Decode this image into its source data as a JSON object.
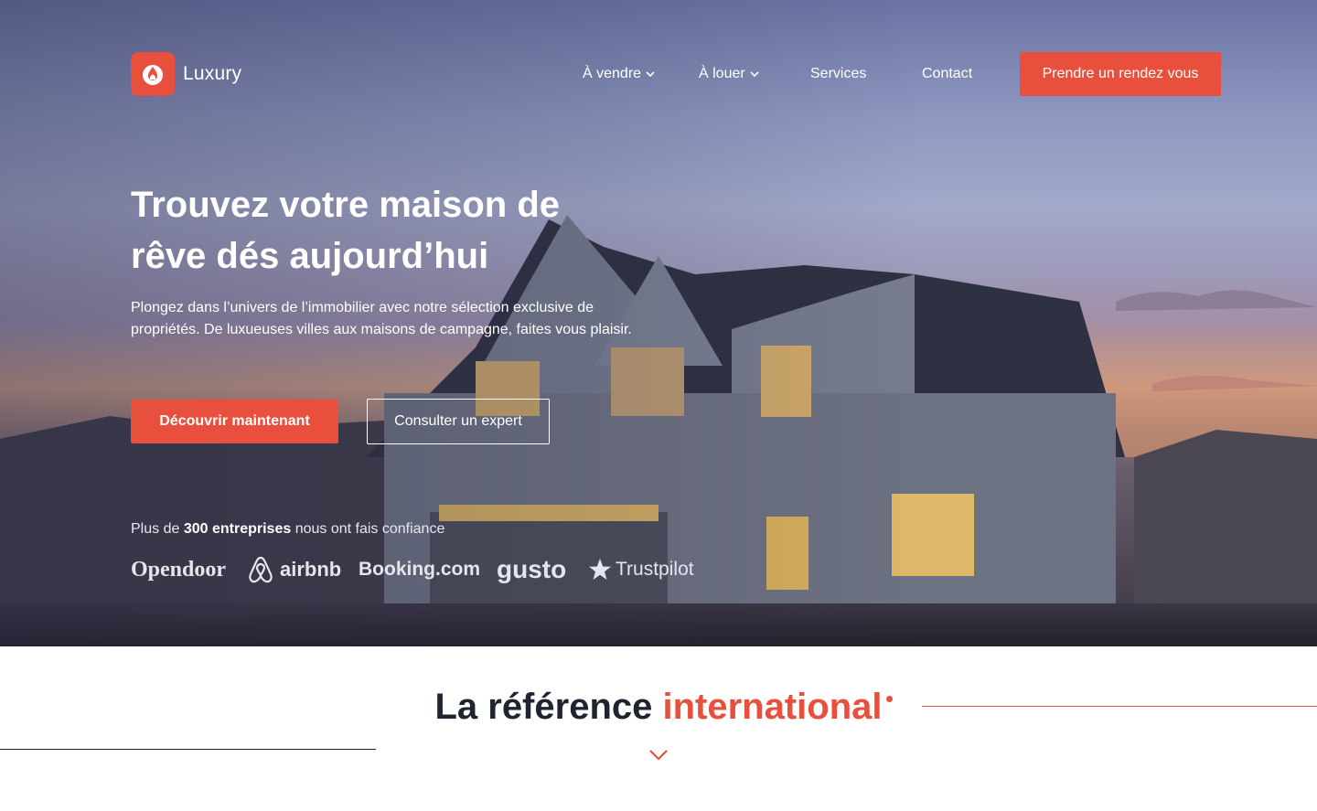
{
  "brand": {
    "name": "Luxury",
    "accent": "#e94f3d"
  },
  "nav": {
    "items": [
      {
        "label": "À vendre",
        "has_dropdown": true
      },
      {
        "label": "À louer",
        "has_dropdown": true
      },
      {
        "label": "Services",
        "has_dropdown": false
      },
      {
        "label": "Contact",
        "has_dropdown": false
      }
    ],
    "cta_label": "Prendre un rendez vous"
  },
  "hero": {
    "headline": "Trouvez votre maison de rêve dés aujourd’hui",
    "subtext": "Plongez dans l’univers de l’immobilier avec notre sélection exclusive de propriétés. De luxueuses villes aux maisons de campagne, faites vous plaisir.",
    "primary_button": "Découvrir maintenant",
    "secondary_button": "Consulter un expert",
    "trust": {
      "prefix": "Plus de",
      "highlight": "300 entreprises",
      "suffix": "nous ont fais confiance"
    },
    "partners": [
      "Opendoor",
      "airbnb",
      "Booking.com",
      "gusto",
      "Trustpilot"
    ]
  },
  "section": {
    "title_plain": "La référence",
    "title_accent": "international"
  },
  "icons": {
    "logo": "house-drop-icon",
    "dropdown": "chevron-down-icon",
    "scroll": "chevron-down-icon",
    "trustpilot": "star-icon",
    "airbnb": "airbnb-belo-icon"
  }
}
